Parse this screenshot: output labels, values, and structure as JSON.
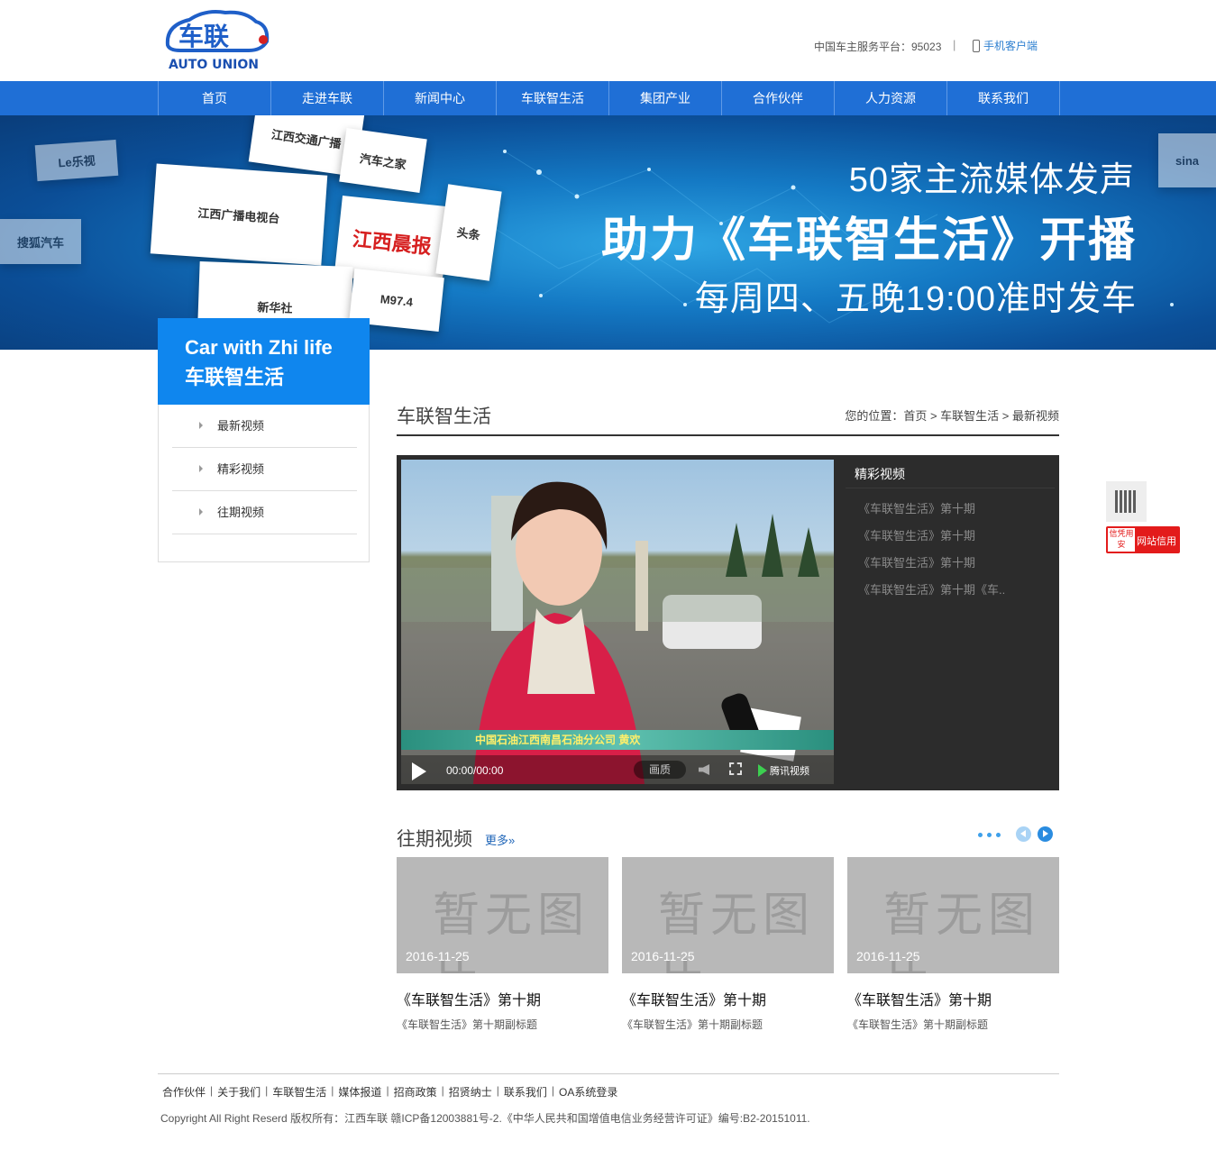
{
  "header": {
    "logo_cn": "车联",
    "logo_en": "AUTO UNION",
    "hotline": "中国车主服务平台：95023",
    "separator": "|",
    "mobile": "手机客户端"
  },
  "nav": [
    "首页",
    "走进车联",
    "新闻中心",
    "车联智生活",
    "集团产业",
    "合作伙伴",
    "人力资源",
    "联系我们"
  ],
  "banner": {
    "line1": "50家主流媒体发声",
    "line2": "助力《车联智生活》开播",
    "line3": "每周四、五晚19:00准时发车",
    "cards": [
      "江西交通广播",
      "江西广播电视台",
      "江西晨报",
      "新华社",
      "头条",
      "M97.4",
      "汽车之家",
      "Le乐视",
      "sina",
      "搜狐汽车"
    ]
  },
  "sidebar": {
    "title_en": "Car with Zhi life",
    "title_cn": "车联智生活",
    "items": [
      "最新视频",
      "精彩视频",
      "往期视频"
    ]
  },
  "main": {
    "title": "车联智生活",
    "breadcrumb": "您的位置：首页 > 车联智生活 > 最新视频"
  },
  "player": {
    "caption": "中国石油江西南昌石油分公司  黄欢",
    "time": "00:00/00:00",
    "quality": "画质",
    "brand": "腾讯视频",
    "playlist_title": "精彩视频",
    "playlist": [
      "《车联智生活》第十期",
      "《车联智生活》第十期",
      "《车联智生活》第十期",
      "《车联智生活》第十期《车.."
    ]
  },
  "past": {
    "title": "往期视频",
    "more": "更多»",
    "no_image": "暂无图片",
    "cards": [
      {
        "date": "2016-11-25",
        "title": "《车联智生活》第十期",
        "subtitle": "《车联智生活》第十期副标题"
      },
      {
        "date": "2016-11-25",
        "title": "《车联智生活》第十期",
        "subtitle": "《车联智生活》第十期副标题"
      },
      {
        "date": "2016-11-25",
        "title": "《车联智生活》第十期",
        "subtitle": "《车联智生活》第十期副标题"
      }
    ]
  },
  "float": {
    "credit_seal": "信凭用安",
    "credit_label": "网站信用"
  },
  "footer": {
    "links": [
      "合作伙伴",
      "关于我们",
      "车联智生活",
      "媒体报道",
      "招商政策",
      "招贤纳士",
      "联系我们",
      "OA系统登录"
    ],
    "copyright": "Copyright All Right Reserd 版权所有：江西车联 赣ICP备12003881号-2.《中华人民共和国增值电信业务经营许可证》编号:B2-20151011."
  },
  "colors": {
    "nav_blue": "#1f6fd6",
    "side_blue": "#0f86ee",
    "link_blue": "#2066b8"
  }
}
